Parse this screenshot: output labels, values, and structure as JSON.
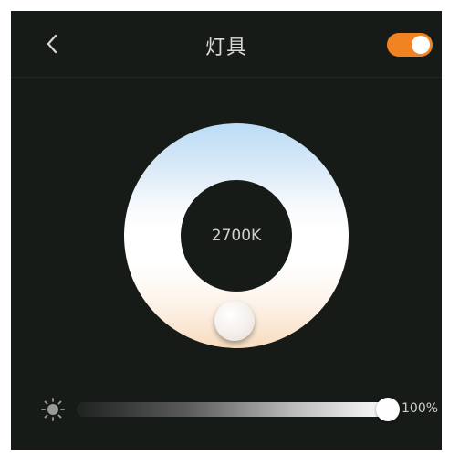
{
  "header": {
    "title": "灯具",
    "back_icon": "chevron-left-icon",
    "power_toggle": {
      "on": true,
      "color": "#f08423"
    }
  },
  "color_temperature": {
    "value_label": "2700K"
  },
  "brightness": {
    "icon": "sun-icon",
    "value": 1.0,
    "value_label": "100%"
  },
  "colors": {
    "background": "#161b18",
    "accent": "#f08423",
    "cool_tone": "#bcdcf6",
    "warm_tone": "#f8dcbf"
  }
}
